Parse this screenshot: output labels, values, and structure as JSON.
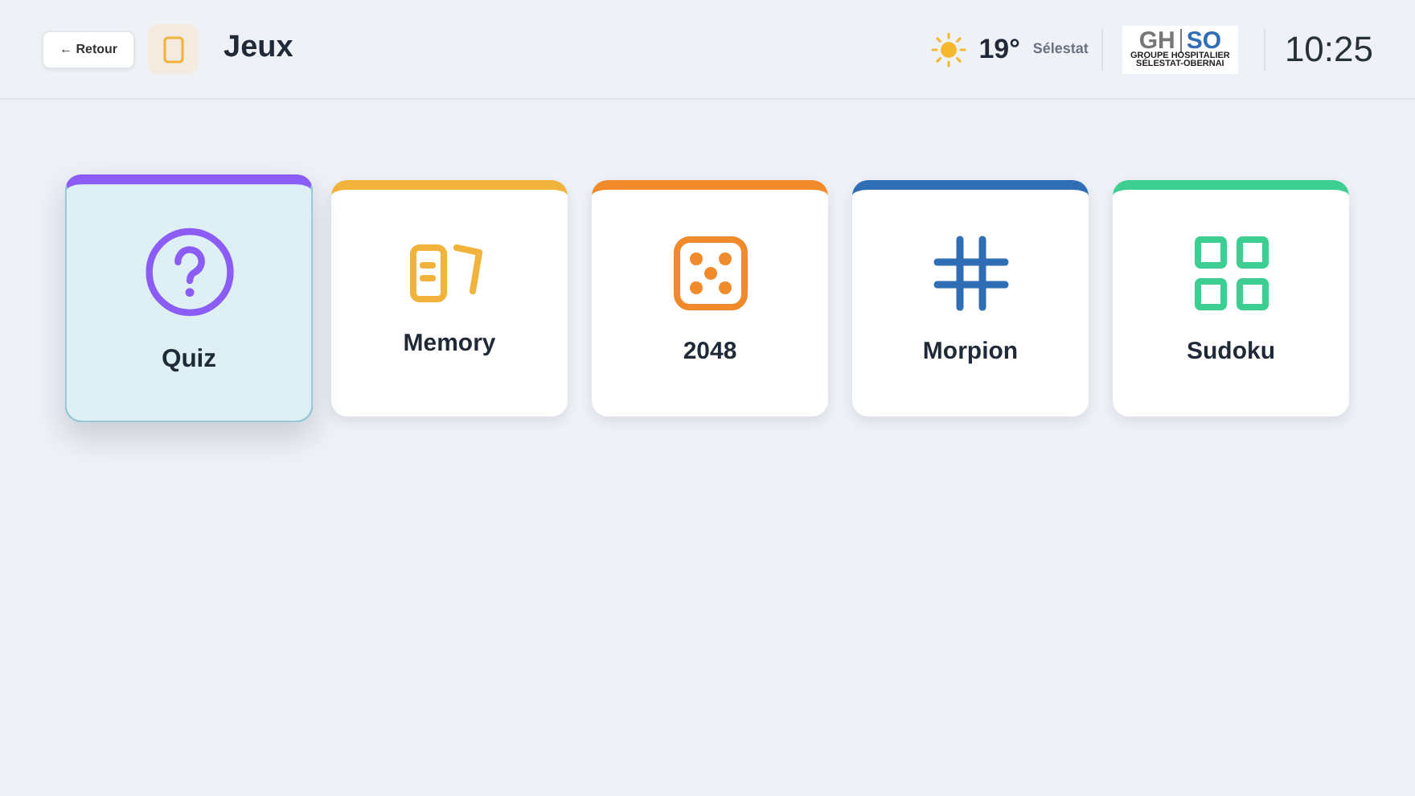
{
  "header": {
    "back_button": "← Retour",
    "title": "Jeux"
  },
  "weather": {
    "temperature": "19°",
    "city": "Sélestat"
  },
  "logo": {
    "left": "GH",
    "right": "SO",
    "line_1": "GROUPE HOSPITALIER",
    "line_2": "SÉLESTAT-OBERNAI"
  },
  "clock": "10:25",
  "games": [
    {
      "label": "Quiz",
      "kind": "question",
      "color": "#8b5cf6",
      "selected": true
    },
    {
      "label": "Memory",
      "kind": "cards",
      "color": "#f2b33d",
      "selected": false
    },
    {
      "label": "2048",
      "kind": "dice",
      "color": "#f08a2a",
      "selected": false
    },
    {
      "label": "Morpion",
      "kind": "hash",
      "color": "#2f6db5",
      "selected": false
    },
    {
      "label": "Sudoku",
      "kind": "grid",
      "color": "#3ccf91",
      "selected": false
    }
  ]
}
